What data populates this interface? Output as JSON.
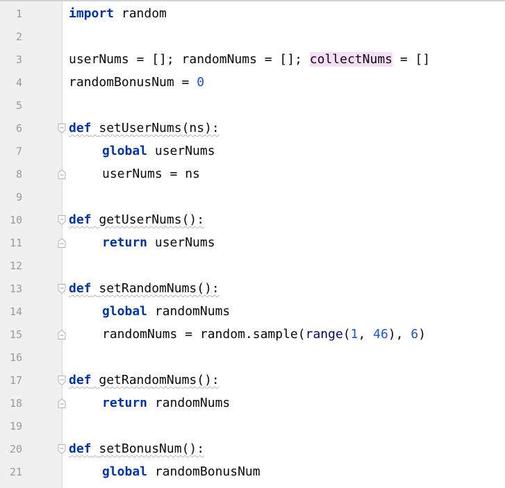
{
  "line_numbers": [
    "1",
    "2",
    "3",
    "4",
    "5",
    "6",
    "7",
    "8",
    "9",
    "10",
    "11",
    "12",
    "13",
    "14",
    "15",
    "16",
    "17",
    "18",
    "19",
    "20",
    "21"
  ],
  "code": {
    "l1_kw": "import",
    "l1_rest": " random",
    "l3_a": "userNums = []; randomNums = []; ",
    "l3_hl": "collectNums",
    "l3_b": " = []",
    "l4_a": "randomBonusNum = ",
    "l4_num": "0",
    "kw_def": "def",
    "kw_global": "global",
    "kw_return": "return",
    "l6_sig": "setUserNums(ns):",
    "l7_rest": "userNums",
    "l8_code": "userNums = ns",
    "l10_sig": "getUserNums():",
    "l11_rest": "userNums",
    "l13_sig": "setRandomNums():",
    "l14_rest": "randomNums",
    "l15_a": "randomNums = random.sample(",
    "l15_builtin": "range",
    "l15_b": "(",
    "l15_n1": "1",
    "l15_c": ", ",
    "l15_n2": "46",
    "l15_d": "), ",
    "l15_n3": "6",
    "l15_e": ")",
    "l17_sig": "getRandomNums():",
    "l18_rest": "randomNums",
    "l20_sig": "setBonusNum():",
    "l21_rest": "randomBonusNum"
  },
  "colors": {
    "keyword": "#0033b3",
    "number": "#1750eb",
    "builtin": "#000080",
    "highlight": "#f7def7",
    "gutter": "#f0f0f0",
    "line_number": "#999999"
  },
  "icons": {
    "fold_start": "fold-start-icon",
    "fold_end": "fold-end-icon"
  }
}
